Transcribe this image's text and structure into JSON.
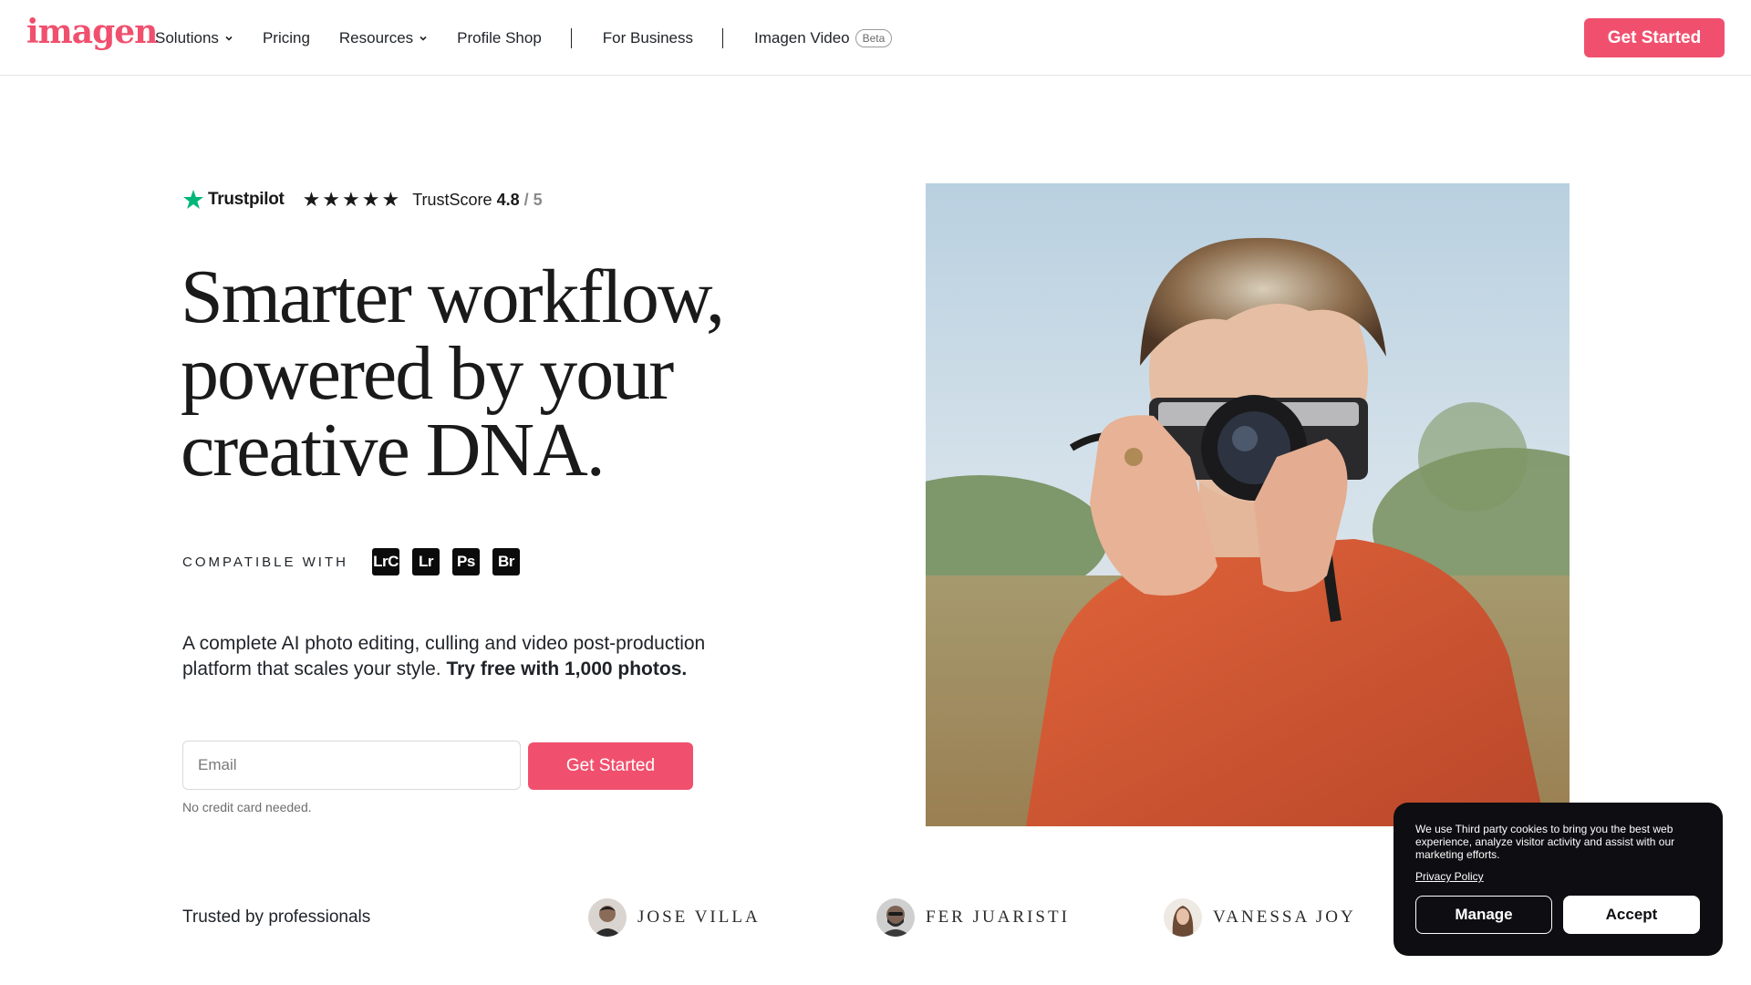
{
  "brand": {
    "logo_text": "imagen",
    "accent": "#f0506e"
  },
  "nav": {
    "items": [
      {
        "label": "Solutions",
        "dropdown": true
      },
      {
        "label": "Pricing"
      },
      {
        "label": "Resources",
        "dropdown": true
      },
      {
        "label": "Profile Shop"
      },
      {
        "label": "For Business"
      },
      {
        "label": "Imagen Video",
        "badge": "Beta"
      }
    ],
    "cta_label": "Get Started"
  },
  "trustpilot": {
    "brand": "Trustpilot",
    "stars": "★★★★★",
    "score_label": "TrustScore",
    "score": "4.8",
    "out_of": "/ 5"
  },
  "hero": {
    "headline_lines": [
      "Smarter workflow,",
      "powered by your",
      "creative DNA."
    ],
    "compatible_label": "COMPATIBLE WITH",
    "apps": [
      "LrC",
      "Lr",
      "Ps",
      "Br"
    ],
    "description": "A complete AI photo editing, culling and video post-production platform that scales your style.",
    "description_bold": "Try free with 1,000 photos.",
    "email_placeholder": "Email",
    "cta_label": "Get Started",
    "note": "No credit card needed."
  },
  "trusted": {
    "label": "Trusted by professionals",
    "pros": [
      "JOSE VILLA",
      "FER JUARISTI",
      "VANESSA JOY"
    ]
  },
  "cookie": {
    "text": "We use Third party cookies to bring you the best web experience, analyze visitor activity and assist with our marketing efforts.",
    "link": "Privacy Policy",
    "manage_label": "Manage",
    "accept_label": "Accept"
  }
}
